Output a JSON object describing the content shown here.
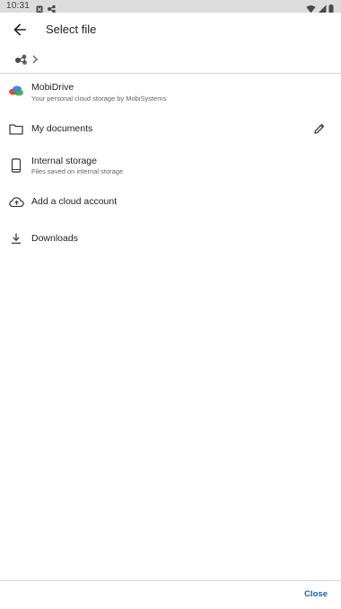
{
  "status_bar": {
    "time": "10:31",
    "left_icons": [
      "notification-icon",
      "mobisystems-icon"
    ],
    "right_icons": [
      "wifi-icon",
      "signal-icon",
      "battery-icon"
    ]
  },
  "app_bar": {
    "title": "Select file",
    "back_icon": "arrow-back-icon"
  },
  "breadcrumb": {
    "root_icon": "mobisystems-logo-icon",
    "separator_icon": "chevron-right-icon"
  },
  "locations": [
    {
      "id": "mobidrive",
      "title": "MobiDrive",
      "subtitle": "Your personal cloud storage by MobiSystems",
      "icon": "mobidrive-icon"
    },
    {
      "id": "my-documents",
      "title": "My documents",
      "subtitle": "",
      "icon": "folder-icon",
      "action_icon": "edit-icon"
    },
    {
      "id": "internal-storage",
      "title": "Internal storage",
      "subtitle": "Files saved on internal storage",
      "icon": "phone-icon"
    },
    {
      "id": "add-cloud-account",
      "title": "Add a cloud account",
      "subtitle": "",
      "icon": "cloud-add-icon"
    },
    {
      "id": "downloads",
      "title": "Downloads",
      "subtitle": "",
      "icon": "download-icon"
    }
  ],
  "footer": {
    "close_label": "Close"
  },
  "colors": {
    "status_bar_bg": "#dcdcdc",
    "accent": "#1a5fb4",
    "text_primary": "#202124",
    "text_secondary": "#5f6368"
  }
}
